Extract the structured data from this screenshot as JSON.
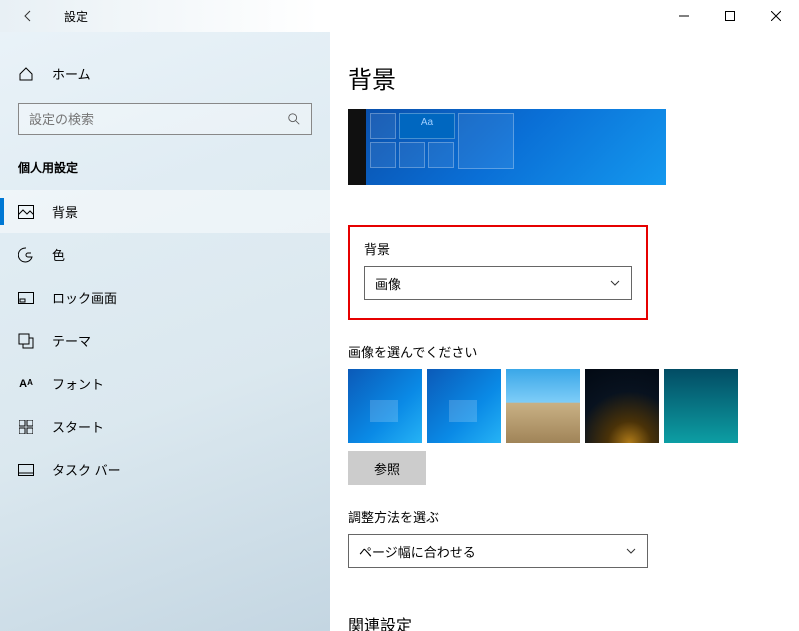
{
  "titlebar": {
    "title": "設定"
  },
  "sidebar": {
    "home": "ホーム",
    "search_placeholder": "設定の検索",
    "category": "個人用設定",
    "items": [
      {
        "label": "背景",
        "active": true
      },
      {
        "label": "色"
      },
      {
        "label": "ロック画面"
      },
      {
        "label": "テーマ"
      },
      {
        "label": "フォント"
      },
      {
        "label": "スタート"
      },
      {
        "label": "タスク バー"
      }
    ]
  },
  "page": {
    "title": "背景",
    "preview_tile_label": "Aa",
    "bg_section_label": "背景",
    "bg_dropdown_value": "画像",
    "choose_label": "画像を選んでください",
    "browse": "参照",
    "fit_label": "調整方法を選ぶ",
    "fit_value": "ページ幅に合わせる",
    "related": "関連設定"
  }
}
